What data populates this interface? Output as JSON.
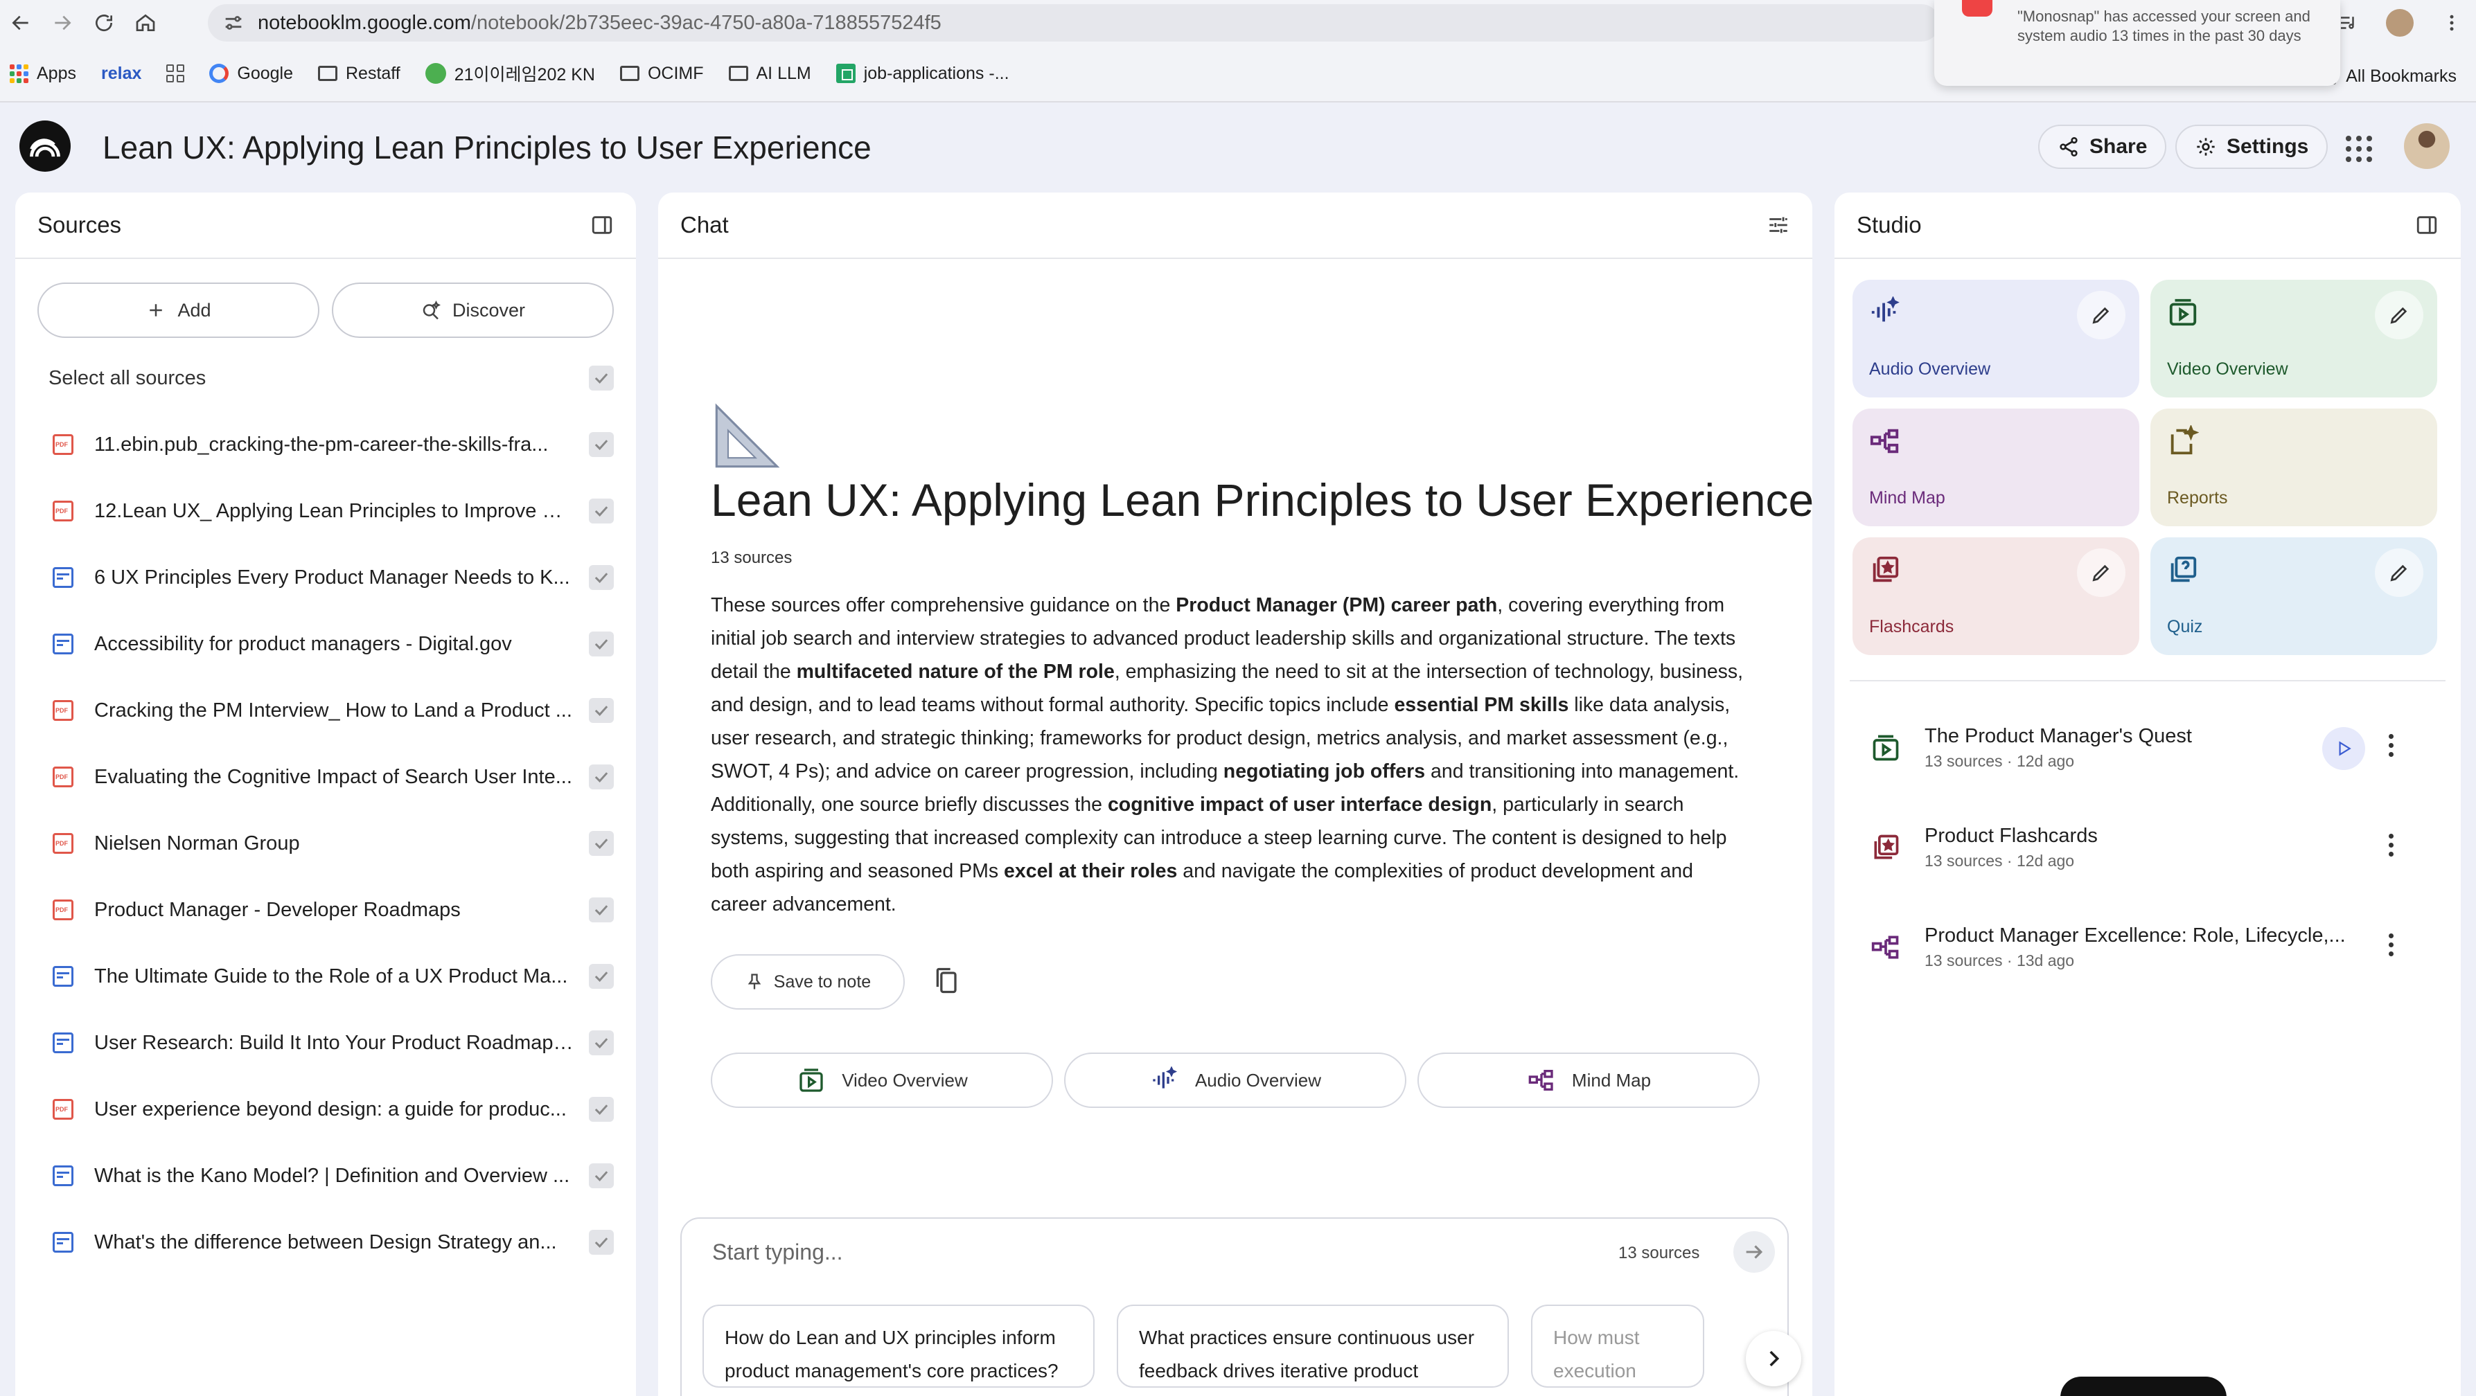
{
  "browser": {
    "url_host": "notebooklm.google.com",
    "url_path": "/notebook/2b735eec-39ac-4750-a80a-7188557524f5",
    "bookmarks": [
      "Apps",
      "relax",
      "Google",
      "Restaff",
      "21이이레임202 KN",
      "OCIMF",
      "AI LLM",
      "job-applications -..."
    ],
    "all_bookmarks": "All Bookmarks",
    "notification": "\"Monosnap\" has accessed your screen and system audio 13 times in the past 30 days"
  },
  "header": {
    "title": "Lean UX: Applying Lean Principles to User Experience",
    "share_label": "Share",
    "settings_label": "Settings"
  },
  "sources": {
    "title": "Sources",
    "add_label": "Add",
    "discover_label": "Discover",
    "select_all_label": "Select all sources",
    "items": [
      {
        "type": "pdf",
        "name": "11.ebin.pub_cracking-the-pm-career-the-skills-fra..."
      },
      {
        "type": "pdf",
        "name": "12.Lean UX_ Applying Lean Principles to Improve Us..."
      },
      {
        "type": "web",
        "name": "6 UX Principles Every Product Manager Needs to K..."
      },
      {
        "type": "web",
        "name": "Accessibility for product managers - Digital.gov"
      },
      {
        "type": "pdf",
        "name": "Cracking the PM Interview_ How to Land a Product ..."
      },
      {
        "type": "pdf",
        "name": "Evaluating the Cognitive Impact of Search User Inte..."
      },
      {
        "type": "pdf",
        "name": "Nielsen Norman Group"
      },
      {
        "type": "pdf",
        "name": "Product Manager - Developer Roadmaps"
      },
      {
        "type": "web",
        "name": "The Ultimate Guide to the Role of a UX Product Ma..."
      },
      {
        "type": "web",
        "name": "User Research: Build It Into Your Product Roadmap ..."
      },
      {
        "type": "pdf",
        "name": "User experience beyond design: a guide for produc..."
      },
      {
        "type": "web",
        "name": "What is the Kano Model? | Definition and Overview ..."
      },
      {
        "type": "web",
        "name": "What's the difference between Design Strategy an..."
      }
    ]
  },
  "chat": {
    "title": "Chat",
    "notebook_title": "Lean UX: Applying Lean Principles to User Experience",
    "source_count": "13 sources",
    "summary_parts": [
      {
        "t": "These sources offer comprehensive guidance on the ",
        "b": false
      },
      {
        "t": "Product Manager (PM) career path",
        "b": true
      },
      {
        "t": ", covering everything from initial job search and interview strategies to advanced product leadership skills and organizational structure. The texts detail the ",
        "b": false
      },
      {
        "t": "multifaceted nature of the PM role",
        "b": true
      },
      {
        "t": ", emphasizing the need to sit at the intersection of technology, business, and design, and to lead teams without formal authority. Specific topics include ",
        "b": false
      },
      {
        "t": "essential PM skills",
        "b": true
      },
      {
        "t": " like data analysis, user research, and strategic thinking; frameworks for product design, metrics analysis, and market assessment (e.g., SWOT, 4 Ps); and advice on career progression, including ",
        "b": false
      },
      {
        "t": "negotiating job offers",
        "b": true
      },
      {
        "t": " and transitioning into management. Additionally, one source briefly discusses the ",
        "b": false
      },
      {
        "t": "cognitive impact of user interface design",
        "b": true
      },
      {
        "t": ", particularly in search systems, suggesting that increased complexity can introduce a steep learning curve. The content is designed to help both aspiring and seasoned PMs ",
        "b": false
      },
      {
        "t": "excel at their roles",
        "b": true
      },
      {
        "t": " and navigate the complexities of product development and career advancement.",
        "b": false
      }
    ],
    "save_to_note_label": "Save to note",
    "generate": {
      "video_label": "Video Overview",
      "audio_label": "Audio Overview",
      "mindmap_label": "Mind Map"
    },
    "composer": {
      "placeholder": "Start typing...",
      "source_count": "13 sources"
    },
    "suggestions": [
      "How do Lean and UX principles inform product management's core practices?",
      "What practices ensure continuous user feedback drives iterative product development decisions?",
      "How must execution"
    ]
  },
  "studio": {
    "title": "Studio",
    "tiles": {
      "audio": "Audio Overview",
      "video": "Video Overview",
      "mind_map": "Mind Map",
      "reports": "Reports",
      "flashcards": "Flashcards",
      "quiz": "Quiz"
    },
    "artifacts": [
      {
        "kind": "video",
        "title": "The Product Manager's Quest",
        "meta": "13 sources · 12d ago"
      },
      {
        "kind": "flashcards",
        "title": "Product Flashcards",
        "meta": "13 sources · 12d ago"
      },
      {
        "kind": "mindmap",
        "title": "Product Manager Excellence: Role, Lifecycle,...",
        "meta": "13 sources · 13d ago"
      }
    ]
  }
}
